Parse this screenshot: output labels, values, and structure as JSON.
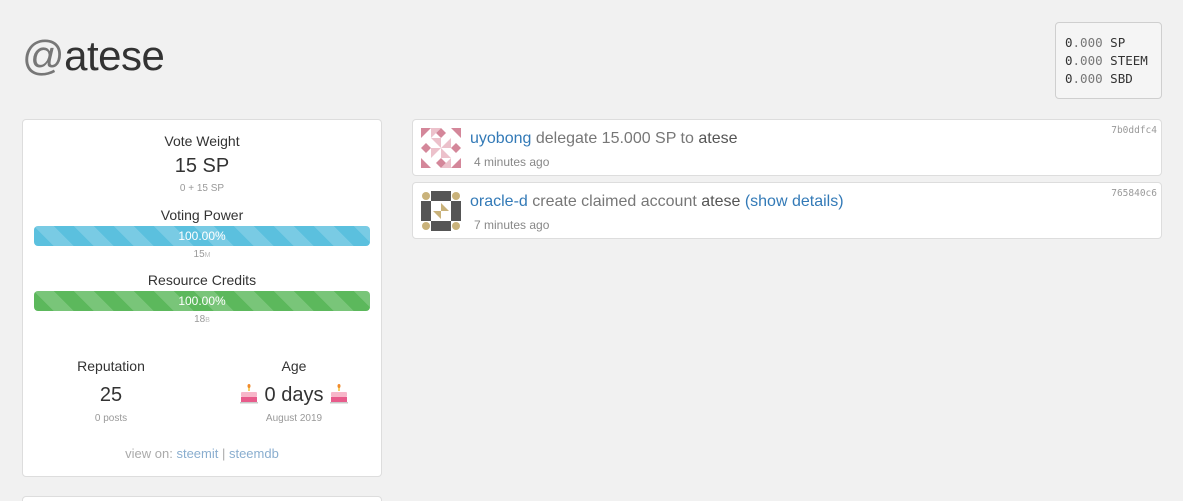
{
  "header": {
    "username_prefix": "@",
    "username": "atese"
  },
  "balances": [
    {
      "int": "0",
      "dec": ".000",
      "unit": "SP"
    },
    {
      "int": "0",
      "dec": ".000",
      "unit": "STEEM"
    },
    {
      "int": "0",
      "dec": ".000",
      "unit": "SBD"
    }
  ],
  "stats": {
    "vote_weight": {
      "title": "Vote Weight",
      "value": "15 SP",
      "detail": "0 + 15 SP"
    },
    "voting_power": {
      "title": "Voting Power",
      "percent_label": "100.00%",
      "fill_fraction": 1.0,
      "sub_value": "15",
      "sub_unit": "M"
    },
    "resource_credits": {
      "title": "Resource Credits",
      "percent_label": "100.00%",
      "fill_fraction": 1.0,
      "sub_value": "18",
      "sub_unit": "B"
    },
    "reputation": {
      "title": "Reputation",
      "value": "25",
      "detail": "0 posts"
    },
    "age": {
      "title": "Age",
      "value": "0 days",
      "detail": "August 2019"
    }
  },
  "view_on": {
    "prefix": "view on: ",
    "links": [
      "steemit",
      "steemdb"
    ],
    "separator": " | "
  },
  "feed": [
    {
      "actor": "uyobong",
      "action": " delegate 15.000 SP to ",
      "target": "atese",
      "details": "",
      "time": "4 minutes ago",
      "hash": "7b0ddfc4"
    },
    {
      "actor": "oracle-d",
      "action": " create claimed account ",
      "target": "atese",
      "details": " (show details)",
      "time": "7 minutes ago",
      "hash": "765840c6"
    }
  ],
  "colors": {
    "link": "#337ab7",
    "bar_blue": "#5bc0de",
    "bar_green": "#5cb85c"
  },
  "icons": {
    "avatar_1": "identicon-pink",
    "avatar_2": "identicon-dark",
    "cake": "birthday-cake-icon"
  }
}
